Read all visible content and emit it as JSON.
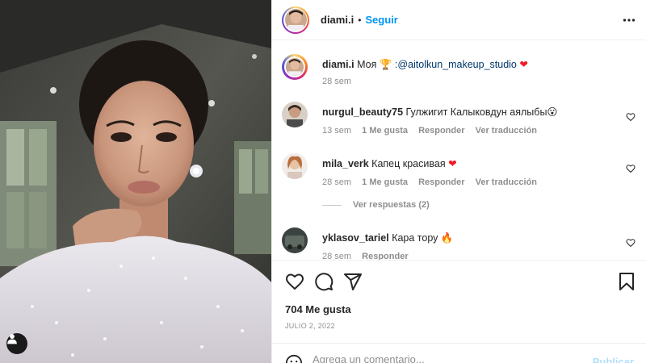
{
  "post": {
    "author": {
      "username": "diami.i",
      "separator": "•",
      "follow_label": "Seguir"
    },
    "caption": {
      "username": "diami.i",
      "text": "Моя",
      "emoji": "🏆",
      "mention": ":@aitolkun_makeup_studio",
      "heart": "❤",
      "time": "28 sem"
    },
    "comments": [
      {
        "username": "nurgul_beauty75",
        "text": "Гулжигит Калыковдун аялыбы😮",
        "time": "13 sem",
        "likes": "1 Me gusta",
        "reply": "Responder",
        "translate": "Ver traducción"
      },
      {
        "username": "mila_verk",
        "text": "Капец красивая",
        "heart": "❤",
        "time": "28 sem",
        "likes": "1 Me gusta",
        "reply": "Responder",
        "translate": "Ver traducción",
        "view_replies": "Ver respuestas (2)"
      },
      {
        "username": "yklasov_tariel",
        "text": "Кара тору",
        "emoji": "🔥",
        "time": "28 sem",
        "reply": "Responder"
      }
    ],
    "likes_count": "704 Me gusta",
    "date": "JULIO 2, 2022",
    "comment_box": {
      "placeholder": "Agrega un comentario...",
      "publish_label": "Publicar"
    },
    "icons": {
      "more": "more-options-icon",
      "like": "heart-icon",
      "comment": "comment-icon",
      "share": "share-icon",
      "save": "bookmark-icon",
      "tag": "user-tag-icon",
      "emoji": "emoji-icon"
    },
    "colors": {
      "accent": "#0095f6",
      "publish_disabled": "#b2dffc",
      "mention": "#00376b",
      "heart": "#ed1c24",
      "muted": "#8e8e8e"
    }
  }
}
